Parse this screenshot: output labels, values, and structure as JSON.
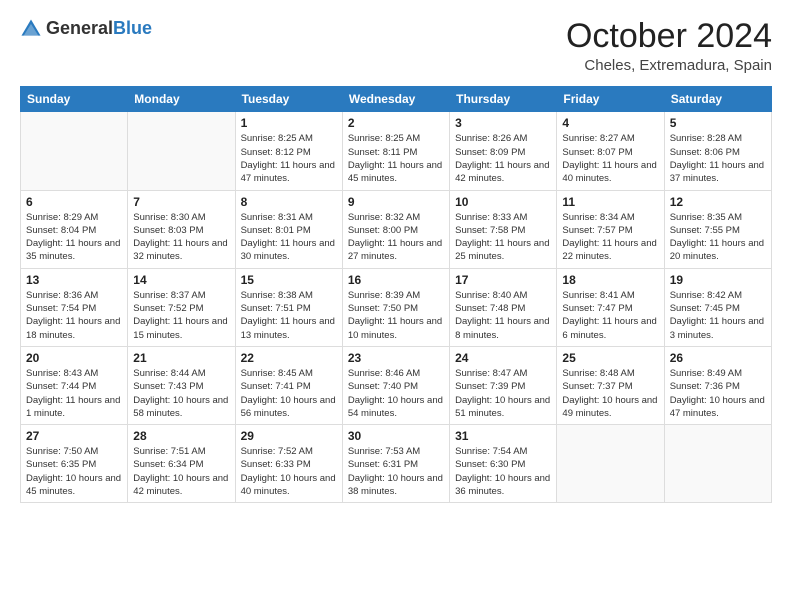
{
  "header": {
    "logo_general": "General",
    "logo_blue": "Blue",
    "title": "October 2024",
    "subtitle": "Cheles, Extremadura, Spain"
  },
  "calendar": {
    "days_of_week": [
      "Sunday",
      "Monday",
      "Tuesday",
      "Wednesday",
      "Thursday",
      "Friday",
      "Saturday"
    ],
    "weeks": [
      [
        {
          "day": "",
          "info": ""
        },
        {
          "day": "",
          "info": ""
        },
        {
          "day": "1",
          "info": "Sunrise: 8:25 AM\nSunset: 8:12 PM\nDaylight: 11 hours and 47 minutes."
        },
        {
          "day": "2",
          "info": "Sunrise: 8:25 AM\nSunset: 8:11 PM\nDaylight: 11 hours and 45 minutes."
        },
        {
          "day": "3",
          "info": "Sunrise: 8:26 AM\nSunset: 8:09 PM\nDaylight: 11 hours and 42 minutes."
        },
        {
          "day": "4",
          "info": "Sunrise: 8:27 AM\nSunset: 8:07 PM\nDaylight: 11 hours and 40 minutes."
        },
        {
          "day": "5",
          "info": "Sunrise: 8:28 AM\nSunset: 8:06 PM\nDaylight: 11 hours and 37 minutes."
        }
      ],
      [
        {
          "day": "6",
          "info": "Sunrise: 8:29 AM\nSunset: 8:04 PM\nDaylight: 11 hours and 35 minutes."
        },
        {
          "day": "7",
          "info": "Sunrise: 8:30 AM\nSunset: 8:03 PM\nDaylight: 11 hours and 32 minutes."
        },
        {
          "day": "8",
          "info": "Sunrise: 8:31 AM\nSunset: 8:01 PM\nDaylight: 11 hours and 30 minutes."
        },
        {
          "day": "9",
          "info": "Sunrise: 8:32 AM\nSunset: 8:00 PM\nDaylight: 11 hours and 27 minutes."
        },
        {
          "day": "10",
          "info": "Sunrise: 8:33 AM\nSunset: 7:58 PM\nDaylight: 11 hours and 25 minutes."
        },
        {
          "day": "11",
          "info": "Sunrise: 8:34 AM\nSunset: 7:57 PM\nDaylight: 11 hours and 22 minutes."
        },
        {
          "day": "12",
          "info": "Sunrise: 8:35 AM\nSunset: 7:55 PM\nDaylight: 11 hours and 20 minutes."
        }
      ],
      [
        {
          "day": "13",
          "info": "Sunrise: 8:36 AM\nSunset: 7:54 PM\nDaylight: 11 hours and 18 minutes."
        },
        {
          "day": "14",
          "info": "Sunrise: 8:37 AM\nSunset: 7:52 PM\nDaylight: 11 hours and 15 minutes."
        },
        {
          "day": "15",
          "info": "Sunrise: 8:38 AM\nSunset: 7:51 PM\nDaylight: 11 hours and 13 minutes."
        },
        {
          "day": "16",
          "info": "Sunrise: 8:39 AM\nSunset: 7:50 PM\nDaylight: 11 hours and 10 minutes."
        },
        {
          "day": "17",
          "info": "Sunrise: 8:40 AM\nSunset: 7:48 PM\nDaylight: 11 hours and 8 minutes."
        },
        {
          "day": "18",
          "info": "Sunrise: 8:41 AM\nSunset: 7:47 PM\nDaylight: 11 hours and 6 minutes."
        },
        {
          "day": "19",
          "info": "Sunrise: 8:42 AM\nSunset: 7:45 PM\nDaylight: 11 hours and 3 minutes."
        }
      ],
      [
        {
          "day": "20",
          "info": "Sunrise: 8:43 AM\nSunset: 7:44 PM\nDaylight: 11 hours and 1 minute."
        },
        {
          "day": "21",
          "info": "Sunrise: 8:44 AM\nSunset: 7:43 PM\nDaylight: 10 hours and 58 minutes."
        },
        {
          "day": "22",
          "info": "Sunrise: 8:45 AM\nSunset: 7:41 PM\nDaylight: 10 hours and 56 minutes."
        },
        {
          "day": "23",
          "info": "Sunrise: 8:46 AM\nSunset: 7:40 PM\nDaylight: 10 hours and 54 minutes."
        },
        {
          "day": "24",
          "info": "Sunrise: 8:47 AM\nSunset: 7:39 PM\nDaylight: 10 hours and 51 minutes."
        },
        {
          "day": "25",
          "info": "Sunrise: 8:48 AM\nSunset: 7:37 PM\nDaylight: 10 hours and 49 minutes."
        },
        {
          "day": "26",
          "info": "Sunrise: 8:49 AM\nSunset: 7:36 PM\nDaylight: 10 hours and 47 minutes."
        }
      ],
      [
        {
          "day": "27",
          "info": "Sunrise: 7:50 AM\nSunset: 6:35 PM\nDaylight: 10 hours and 45 minutes."
        },
        {
          "day": "28",
          "info": "Sunrise: 7:51 AM\nSunset: 6:34 PM\nDaylight: 10 hours and 42 minutes."
        },
        {
          "day": "29",
          "info": "Sunrise: 7:52 AM\nSunset: 6:33 PM\nDaylight: 10 hours and 40 minutes."
        },
        {
          "day": "30",
          "info": "Sunrise: 7:53 AM\nSunset: 6:31 PM\nDaylight: 10 hours and 38 minutes."
        },
        {
          "day": "31",
          "info": "Sunrise: 7:54 AM\nSunset: 6:30 PM\nDaylight: 10 hours and 36 minutes."
        },
        {
          "day": "",
          "info": ""
        },
        {
          "day": "",
          "info": ""
        }
      ]
    ]
  }
}
